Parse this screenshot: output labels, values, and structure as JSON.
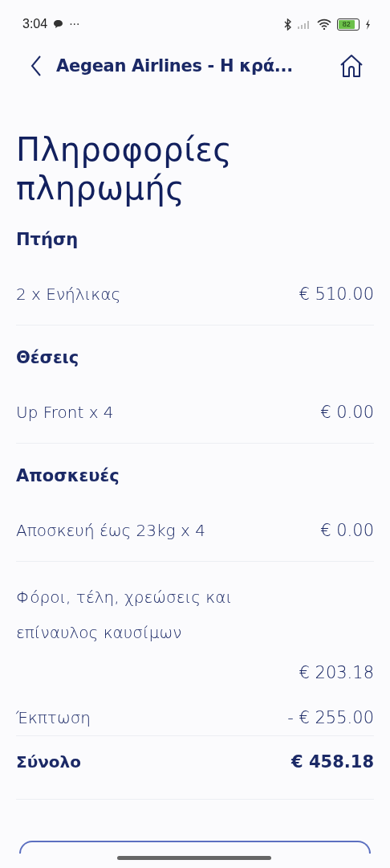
{
  "status_bar": {
    "time": "3:04",
    "dots": "···",
    "battery": "82"
  },
  "header": {
    "title": "Aegean Airlines - Η κρά..."
  },
  "page_title": "Πληροφορίες πληρωμής",
  "lines": [
    {
      "kind": "heading",
      "label": "Πτήση"
    },
    {
      "kind": "item",
      "label": "2 x Ενήλικας",
      "amount": "€ 510.00"
    },
    {
      "kind": "heading",
      "label": "Θέσεις"
    },
    {
      "kind": "item",
      "label": "Up Front x 4",
      "amount": "€ 0.00"
    },
    {
      "kind": "heading",
      "label": "Αποσκευές"
    },
    {
      "kind": "item",
      "label": "Αποσκευή έως 23kg x 4",
      "amount": "€ 0.00"
    },
    {
      "kind": "wrapped",
      "label": "Φόροι, τέλη, χρεώσεις και επίναυλος καυσίμων",
      "amount": "€ 203.18"
    },
    {
      "kind": "discount",
      "label": "Έκπτωση",
      "amount": "- € 255.00"
    },
    {
      "kind": "total",
      "label": "Σύνολο",
      "amount": "€ 458.18"
    }
  ]
}
